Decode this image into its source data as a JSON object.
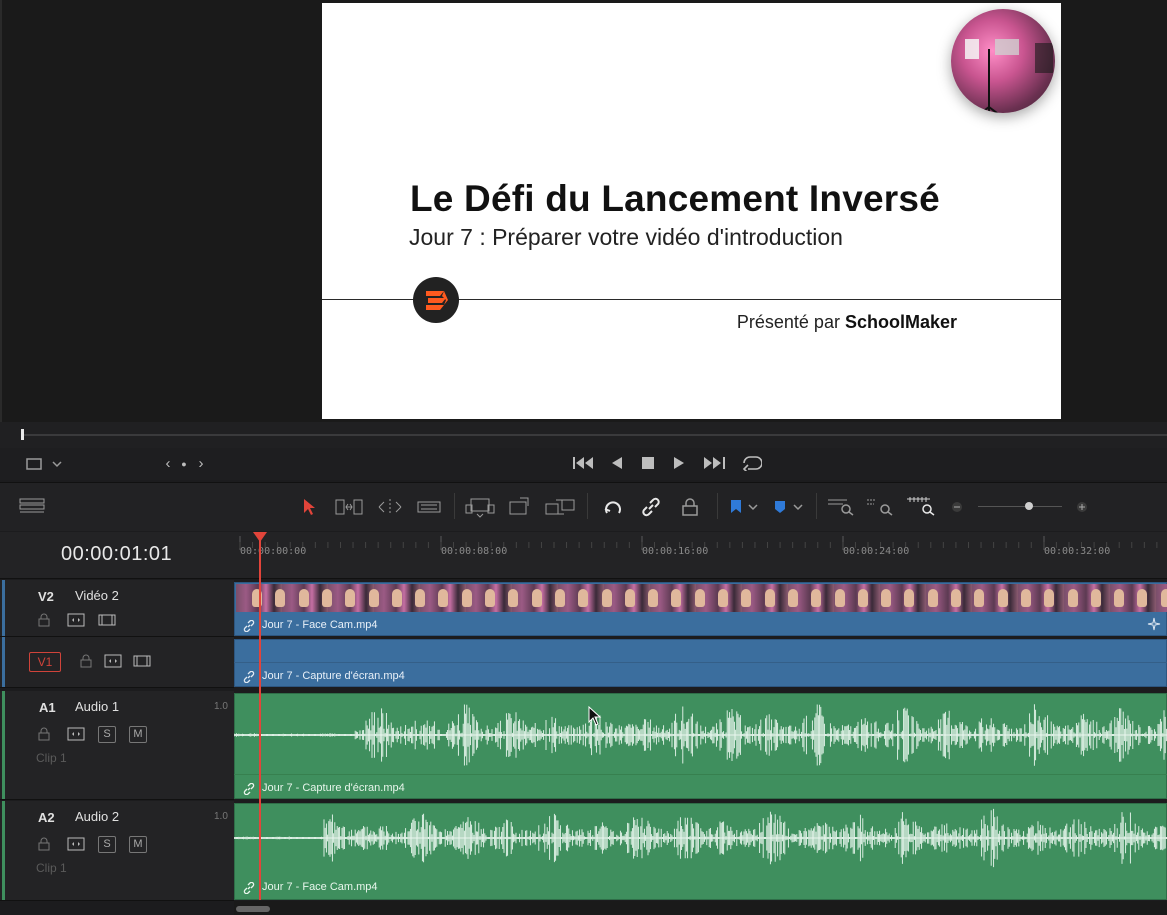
{
  "viewer": {
    "slide_title": "Le Défi du Lancement Inversé",
    "slide_subtitle": "Jour 7 : Préparer votre vidéo d'introduction",
    "presented_prefix": "Présenté par ",
    "presented_brand": "SchoolMaker"
  },
  "transport": {
    "nav_prev": "‹",
    "nav_dot": "●",
    "nav_next": "›"
  },
  "timeline": {
    "timecode": "00:00:01:01",
    "ruler_ticks": [
      "00:00:00:00",
      "00:00:08:00",
      "00:00:16:00",
      "00:00:24:00",
      "00:00:32:00"
    ],
    "tracks": [
      {
        "id": "V2",
        "name": "Vidéo 2",
        "clip": "Jour 7 - Face Cam.mp4"
      },
      {
        "id": "V1",
        "name": "",
        "clip": "Jour 7 - Capture d'écran.mp4"
      },
      {
        "id": "A1",
        "name": "Audio 1",
        "volume": "1.0",
        "sublabel": "Clip 1",
        "clip": "Jour 7 - Capture d'écran.mp4"
      },
      {
        "id": "A2",
        "name": "Audio 2",
        "volume": "1.0",
        "sublabel": "Clip 1",
        "clip": "Jour 7 - Face Cam.mp4"
      }
    ],
    "solo_label": "S",
    "mute_label": "M"
  },
  "colors": {
    "playhead": "#e2443a",
    "video_clip": "#3b6e9e",
    "audio_clip": "#3f8f5e",
    "selection_tool": "#e2443a",
    "flag": "#2f7ad8"
  }
}
